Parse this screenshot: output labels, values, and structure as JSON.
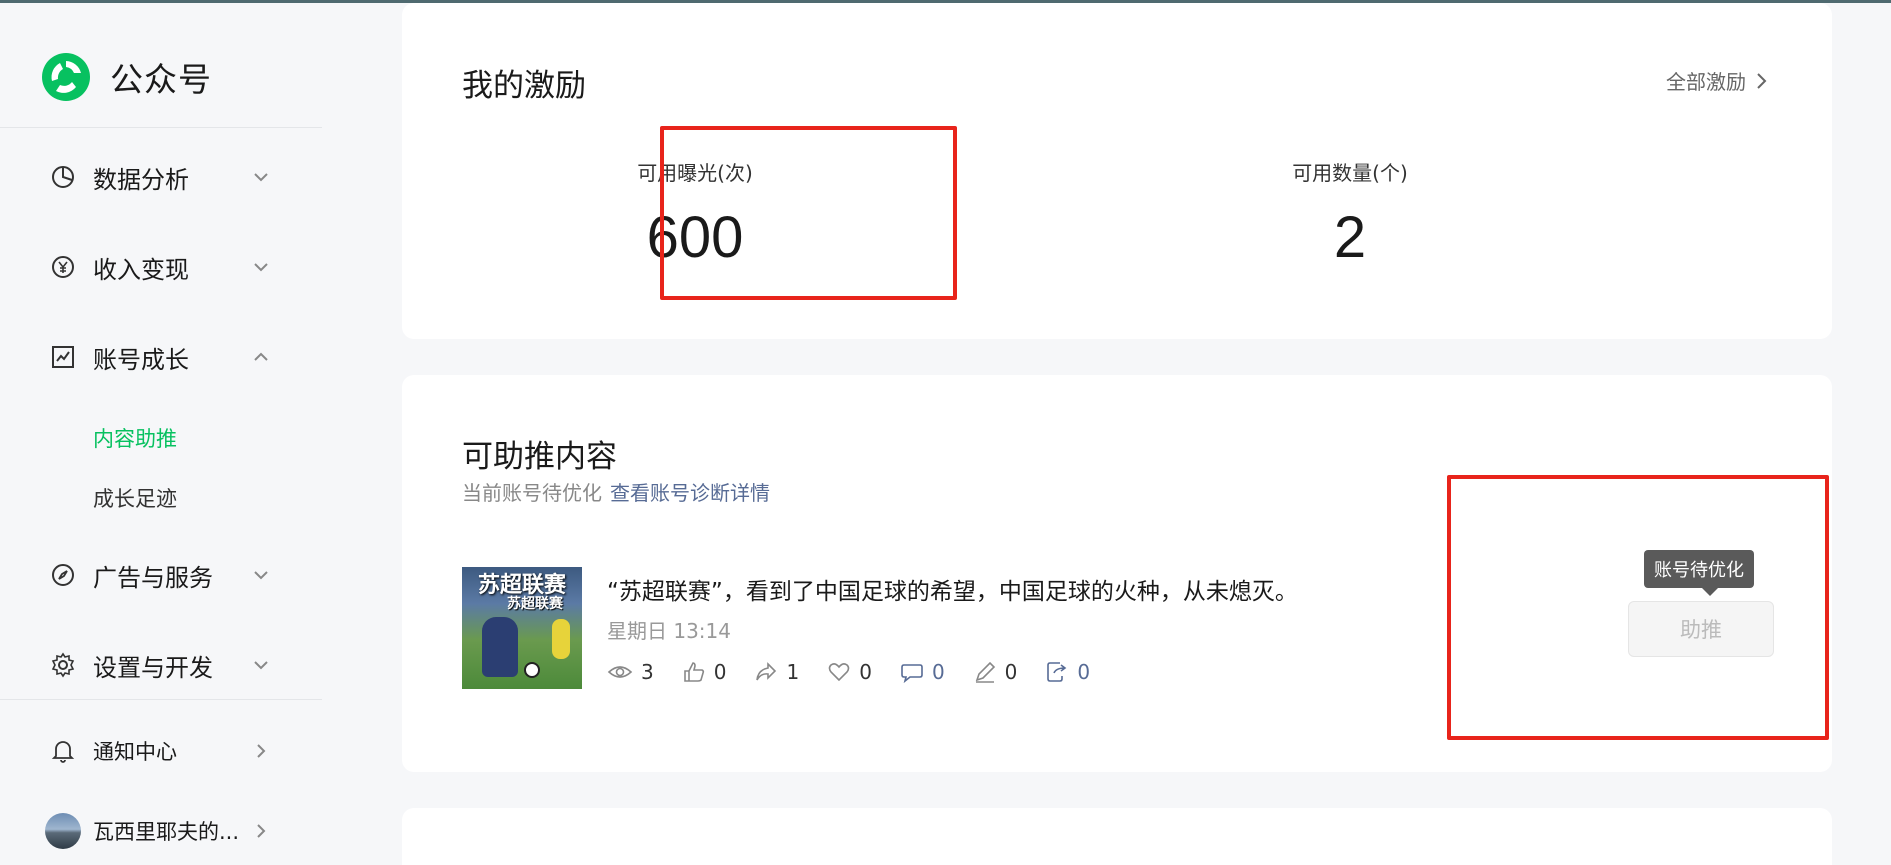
{
  "sidebar": {
    "brand": "公众号",
    "nav": [
      {
        "label": "数据分析",
        "icon": "pie-chart-icon",
        "expanded": false
      },
      {
        "label": "收入变现",
        "icon": "yen-icon",
        "expanded": false
      },
      {
        "label": "账号成长",
        "icon": "trend-chart-icon",
        "expanded": true
      },
      {
        "label": "广告与服务",
        "icon": "compass-icon",
        "expanded": false
      },
      {
        "label": "设置与开发",
        "icon": "gear-icon",
        "expanded": false
      }
    ],
    "growth_sub": [
      {
        "label": "内容助推",
        "active": true
      },
      {
        "label": "成长足迹",
        "active": false
      }
    ],
    "notifications": "通知中心",
    "user_name": "瓦西里耶夫的..."
  },
  "incentives": {
    "title": "我的激励",
    "all_link": "全部激励",
    "exposure_label": "可用曝光(次)",
    "exposure_value": "600",
    "count_label": "可用数量(个)",
    "count_value": "2"
  },
  "boostable": {
    "title": "可助推内容",
    "status_text": "当前账号待优化",
    "diagnosis_link": "查看账号诊断详情",
    "article": {
      "thumb_title": "苏超联赛",
      "thumb_sub": "苏超联赛",
      "title": "“苏超联赛”，看到了中国足球的希望，中国足球的火种，从未熄灭。",
      "time": "星期日 13:14",
      "metrics": {
        "views": "3",
        "likes": "0",
        "shares": "1",
        "favorites": "0",
        "comments": "0",
        "notes": "0",
        "forwards": "0"
      }
    },
    "tooltip": "账号待优化",
    "boost_button": "助推"
  },
  "colors": {
    "accent": "#07c160",
    "link": "#576b95",
    "highlight": "#e8241b"
  }
}
